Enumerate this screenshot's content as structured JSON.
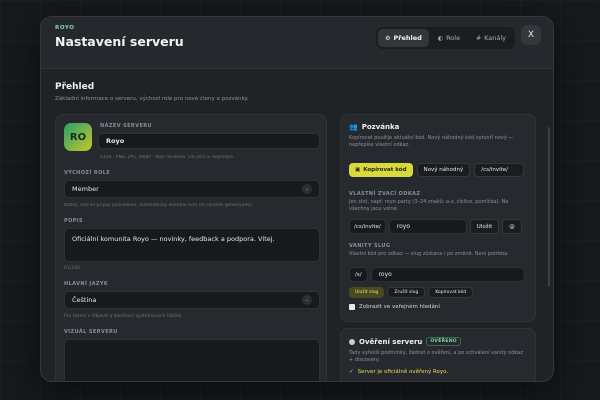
{
  "header": {
    "kicker": "ROYO",
    "title": "Nastavení serveru",
    "tabs": [
      {
        "label": "Přehled",
        "icon": "gear-icon",
        "glyph": "⚙"
      },
      {
        "label": "Role",
        "icon": "shield-icon",
        "glyph": "◐"
      },
      {
        "label": "Kanály",
        "icon": "hash-icon",
        "glyph": "#"
      }
    ],
    "close_glyph": "X"
  },
  "overview": {
    "title": "Přehled",
    "subtitle": "Základní informace o serveru, výchozí role pro nové členy a pozvánky."
  },
  "left": {
    "avatar_text": "RO",
    "name_label": "NÁZEV SERVERU",
    "name_value": "Royo",
    "avatar_hint": "4100 · PNG, JPG, WebP · Max na ikonu. OR jora ui doplnějte.",
    "role_label": "VÝCHOZÍ ROLE",
    "role_value": "Member",
    "role_hint": "Každý, kdo se připojí pozvánkou, automaticky dostane tuto roli (kromě @everyone).",
    "desc_label": "POPIS",
    "desc_value": "Oficiální komunita Royo — novinky, feedback a podpora. Vítej.",
    "desc_counter": "61/240",
    "lang_label": "HLAVNÍ JAZYK",
    "lang_value": "Čeština",
    "lang_hint": "Pro řazení v Objevit a lokalizaci systémových hlášek.",
    "visual_label": "VIZUÁL SERVERU"
  },
  "invite": {
    "title": "Pozvánka",
    "desc": "Kopírovat použije aktuální kód. Nový náhodný kód vytvoří nový — nepřepíše vlastní odkaz.",
    "copy_label": "Kopírovat kód",
    "new_label": "Nový náhodný",
    "code_value": "/cs/invite/",
    "vanity_label": "VLASTNÍ ZVACÍ ODKAZ",
    "vanity_desc": "Jen slot, např. royo-party (3–24 znaků: a-z, číslice, pomlčka). Ne všechny jsou volné.",
    "vanity_prefix": "/cs/invite/",
    "vanity_value": "royo",
    "save_label": "Uložit",
    "refresh_glyph": "@",
    "slug_label": "VANITY SLUG",
    "slug_desc": "Vlastní kód pro odkaz — slug zůstane i po změně. Není potřeba.",
    "slug_prefix": "/s/",
    "slug_value": "royo",
    "chip1": "Uložit slug",
    "chip2": "Zrušit slug",
    "chip3": "Kopírovat kód",
    "discover_label": "Zobrazit ve veřejném hledání"
  },
  "verify": {
    "title": "Ověření serveru",
    "badge": "OVĚŘENO",
    "desc": "Tady vyřešíš podmínky, žádost o ověření, a po schválení vanity odkaz + discovery.",
    "status": "Server je oficiálně ověřený Royo."
  },
  "colors": {
    "accent": "#d9d93a",
    "green": "#7dd8a6",
    "bg": "#202326"
  }
}
